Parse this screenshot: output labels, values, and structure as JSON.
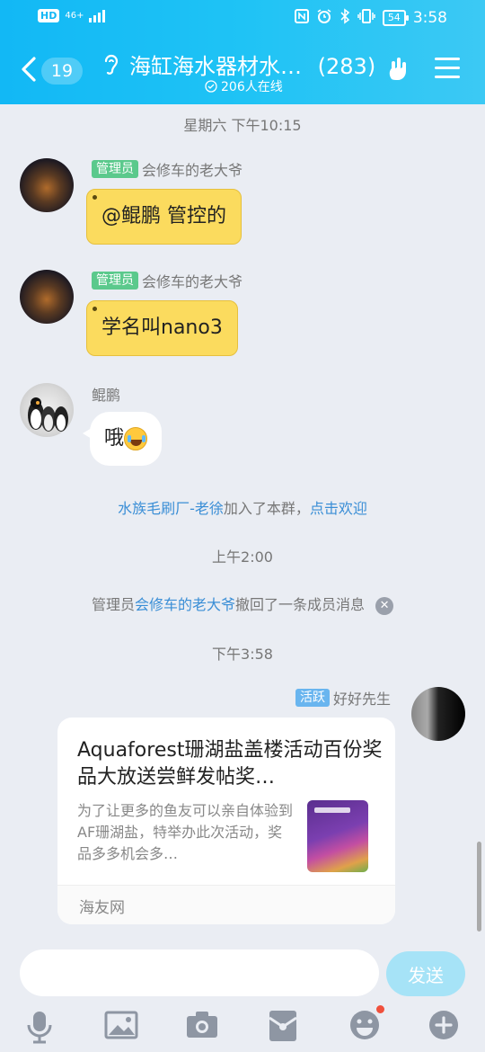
{
  "status_bar": {
    "hd": "HD",
    "network": "46+",
    "battery": "54",
    "time": "3:58"
  },
  "header": {
    "back_count": "19",
    "title": "海缸海水器材水…",
    "member_count": "(283)",
    "online": "206人在线"
  },
  "messages": [
    {
      "type": "time",
      "text": "星期六 下午10:15"
    },
    {
      "type": "msg",
      "badge": "管理员",
      "sender": "会修车的老大爷",
      "text": "@鲲鹏 管控的"
    },
    {
      "type": "msg",
      "badge": "管理员",
      "sender": "会修车的老大爷",
      "text": "学名叫nano3"
    },
    {
      "type": "msg",
      "sender": "鲲鹏",
      "text": "哦"
    },
    {
      "type": "system",
      "link_name": "水族毛刷厂-老徐",
      "middle": "加入了本群，",
      "action": "点击欢迎"
    },
    {
      "type": "time",
      "text": "上午2:00"
    },
    {
      "type": "system",
      "prefix": "管理员",
      "link_name": "会修车的老大爷",
      "middle": "撤回了一条成员消息"
    },
    {
      "type": "time",
      "text": "下午3:58"
    },
    {
      "type": "card",
      "badge": "活跃",
      "sender": "好好先生",
      "title": "Aquaforest珊湖盐盖楼活动百份奖品大放送尝鲜发帖奖…",
      "description": "为了让更多的鱼友可以亲自体验到AF珊湖盐，特举办此次活动，奖品多多机会多…",
      "source": "海友网"
    }
  ],
  "input": {
    "placeholder": "",
    "value": "",
    "send_label": "发送"
  },
  "toolbar_icons": [
    "mic-icon",
    "image-icon",
    "camera-icon",
    "red-packet-icon",
    "emoji-icon",
    "plus-icon"
  ],
  "colors": {
    "header": "#12b8f5",
    "admin_badge": "#5bc98c",
    "active_badge": "#69b5ef",
    "bubble_yellow": "#fbdb5e",
    "link": "#3a8ed6",
    "send_disabled": "#a6e3f7"
  }
}
